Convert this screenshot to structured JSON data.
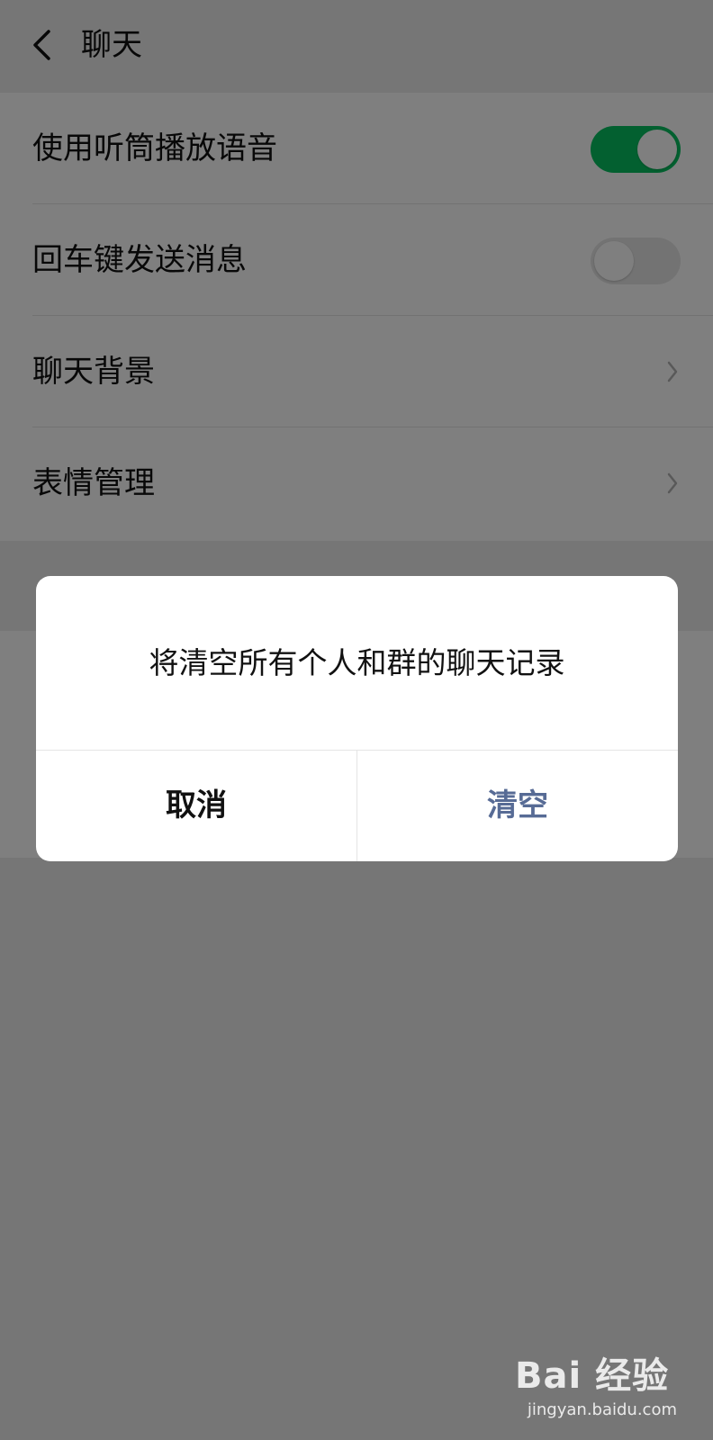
{
  "header": {
    "title": "聊天"
  },
  "settings": {
    "use_earpiece": {
      "label": "使用听筒播放语音",
      "enabled": true
    },
    "enter_to_send": {
      "label": "回车键发送消息",
      "enabled": false
    },
    "chat_background": {
      "label": "聊天背景"
    },
    "sticker_management": {
      "label": "表情管理"
    }
  },
  "dialog": {
    "message": "将清空所有个人和群的聊天记录",
    "cancel_label": "取消",
    "confirm_label": "清空"
  },
  "watermark": {
    "brand": "Bai 经验",
    "url": "jingyan.baidu.com"
  },
  "colors": {
    "toggle_on": "#07c160",
    "confirm_text": "#576b95",
    "overlay": "rgba(0,0,0,0.5)"
  }
}
